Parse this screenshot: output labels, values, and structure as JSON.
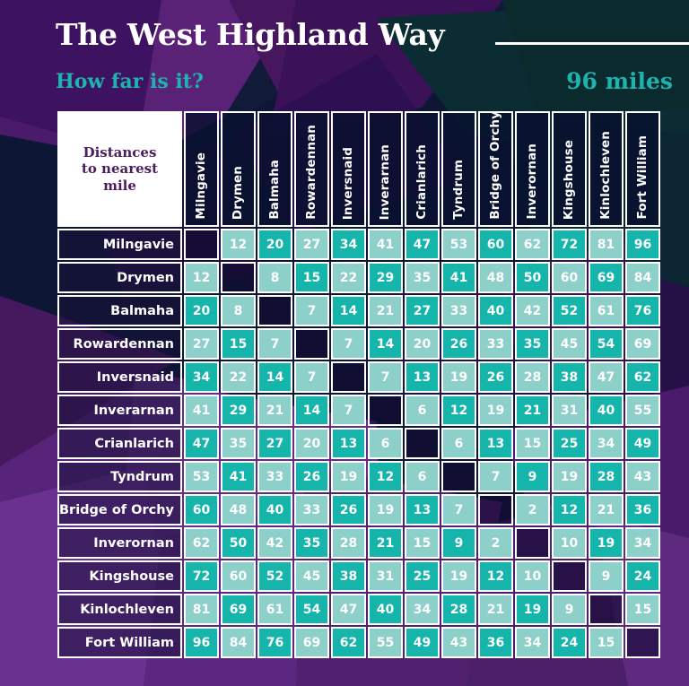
{
  "header": {
    "title": "The West Highland Way",
    "subtitle": "How far is it?",
    "distance_total": "96 miles"
  },
  "matrix": {
    "corner_label": "Distances to nearest mile",
    "corner_lines": [
      "Distances",
      "to nearest",
      "mile"
    ],
    "places": [
      "Milngavie",
      "Drymen",
      "Balmaha",
      "Rowardennan",
      "Inversnaid",
      "Inverarnan",
      "Crianlarich",
      "Tyndrum",
      "Bridge of Orchy",
      "Inverornan",
      "Kingshouse",
      "Kinlochleven",
      "Fort William"
    ],
    "rows": [
      {
        "label": "Milngavie",
        "values": [
          null,
          12,
          20,
          27,
          34,
          41,
          47,
          53,
          60,
          62,
          72,
          81,
          96
        ]
      },
      {
        "label": "Drymen",
        "values": [
          12,
          null,
          8,
          15,
          22,
          29,
          35,
          41,
          48,
          50,
          60,
          69,
          84
        ]
      },
      {
        "label": "Balmaha",
        "values": [
          20,
          8,
          null,
          7,
          14,
          21,
          27,
          33,
          40,
          42,
          52,
          61,
          76
        ]
      },
      {
        "label": "Rowardennan",
        "values": [
          27,
          15,
          7,
          null,
          7,
          14,
          20,
          26,
          33,
          35,
          45,
          54,
          69
        ]
      },
      {
        "label": "Inversnaid",
        "values": [
          34,
          22,
          14,
          7,
          null,
          7,
          13,
          19,
          26,
          28,
          38,
          47,
          62
        ]
      },
      {
        "label": "Inverarnan",
        "values": [
          41,
          29,
          21,
          14,
          7,
          null,
          6,
          12,
          19,
          21,
          31,
          40,
          55
        ]
      },
      {
        "label": "Crianlarich",
        "values": [
          47,
          35,
          27,
          20,
          13,
          6,
          null,
          6,
          13,
          15,
          25,
          34,
          49
        ]
      },
      {
        "label": "Tyndrum",
        "values": [
          53,
          41,
          33,
          26,
          19,
          12,
          6,
          null,
          7,
          9,
          19,
          28,
          43
        ]
      },
      {
        "label": "Bridge of Orchy",
        "values": [
          60,
          48,
          40,
          33,
          26,
          19,
          13,
          7,
          null,
          2,
          12,
          21,
          36
        ]
      },
      {
        "label": "Inverornan",
        "values": [
          62,
          50,
          42,
          35,
          28,
          21,
          15,
          9,
          2,
          null,
          10,
          19,
          34
        ]
      },
      {
        "label": "Kingshouse",
        "values": [
          72,
          60,
          52,
          45,
          38,
          31,
          25,
          19,
          12,
          10,
          null,
          9,
          24
        ]
      },
      {
        "label": "Kinlochleven",
        "values": [
          81,
          69,
          61,
          54,
          47,
          40,
          34,
          28,
          21,
          19,
          9,
          null,
          15
        ]
      },
      {
        "label": "Fort William",
        "values": [
          96,
          84,
          76,
          69,
          62,
          55,
          49,
          43,
          36,
          34,
          24,
          15,
          null
        ]
      }
    ]
  },
  "colors": {
    "accent_teal": "#1fb3ae",
    "cell_light": "#8dcfc9",
    "cell_dark": "#15b5ac",
    "corner_text": "#4b1c5e",
    "white": "#ffffff",
    "bg_navy": "#0b1430",
    "bg_purple": "#4b1f69"
  }
}
